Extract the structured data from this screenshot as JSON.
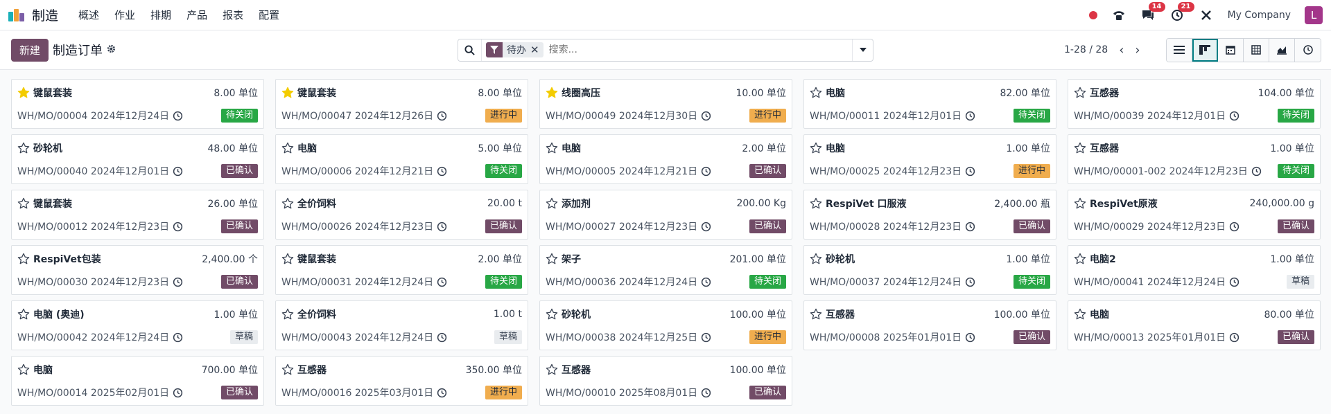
{
  "app": {
    "title": "制造",
    "menu": [
      "概述",
      "作业",
      "排期",
      "产品",
      "报表",
      "配置"
    ],
    "chat_count": "14",
    "activity_count": "21",
    "company": "My Company",
    "avatar_letter": "L"
  },
  "control": {
    "new_label": "新建",
    "page_title": "制造订单",
    "facet": "待办",
    "search_placeholder": "搜索...",
    "pager": "1-28 / 28"
  },
  "colors": {
    "brand": "#714b67",
    "to_close": "#28a745",
    "in_progress": "#f0ad4e",
    "confirmed": "#714b67",
    "draft": "#e9ecef",
    "star": "#f3cc00"
  },
  "records": [
    {
      "product": "键鼠套装",
      "qty": "8.00 单位",
      "ref": "WH/MO/00004 2024年12月24日",
      "status": "待关闭",
      "state": "toclose",
      "starred": true
    },
    {
      "product": "键鼠套装",
      "qty": "8.00 单位",
      "ref": "WH/MO/00047 2024年12月26日",
      "status": "进行中",
      "state": "progress",
      "starred": true
    },
    {
      "product": "线圈高压",
      "qty": "10.00 单位",
      "ref": "WH/MO/00049 2024年12月30日",
      "status": "进行中",
      "state": "progress",
      "starred": true
    },
    {
      "product": "电脑",
      "qty": "82.00 单位",
      "ref": "WH/MO/00011 2024年12月01日",
      "status": "待关闭",
      "state": "toclose",
      "starred": false
    },
    {
      "product": "互感器",
      "qty": "104.00 单位",
      "ref": "WH/MO/00039 2024年12月01日",
      "status": "待关闭",
      "state": "toclose",
      "starred": false
    },
    {
      "product": "砂轮机",
      "qty": "48.00 单位",
      "ref": "WH/MO/00040 2024年12月01日",
      "status": "已确认",
      "state": "confirmed",
      "starred": false
    },
    {
      "product": "电脑",
      "qty": "5.00 单位",
      "ref": "WH/MO/00006 2024年12月21日",
      "status": "待关闭",
      "state": "toclose",
      "starred": false
    },
    {
      "product": "电脑",
      "qty": "2.00 单位",
      "ref": "WH/MO/00005 2024年12月21日",
      "status": "已确认",
      "state": "confirmed",
      "starred": false
    },
    {
      "product": "电脑",
      "qty": "1.00 单位",
      "ref": "WH/MO/00025 2024年12月23日",
      "status": "进行中",
      "state": "progress",
      "starred": false
    },
    {
      "product": "互感器",
      "qty": "1.00 单位",
      "ref": "WH/MO/00001-002 2024年12月23日",
      "status": "待关闭",
      "state": "toclose",
      "starred": false
    },
    {
      "product": "键鼠套装",
      "qty": "26.00 单位",
      "ref": "WH/MO/00012 2024年12月23日",
      "status": "已确认",
      "state": "confirmed",
      "starred": false
    },
    {
      "product": "全价饲料",
      "qty": "20.00 t",
      "ref": "WH/MO/00026 2024年12月23日",
      "status": "已确认",
      "state": "confirmed",
      "starred": false
    },
    {
      "product": "添加剂",
      "qty": "200.00 Kg",
      "ref": "WH/MO/00027 2024年12月23日",
      "status": "已确认",
      "state": "confirmed",
      "starred": false
    },
    {
      "product": "RespiVet 口服液",
      "qty": "2,400.00 瓶",
      "ref": "WH/MO/00028 2024年12月23日",
      "status": "已确认",
      "state": "confirmed",
      "starred": false
    },
    {
      "product": "RespiVet原液",
      "qty": "240,000.00 g",
      "ref": "WH/MO/00029 2024年12月23日",
      "status": "已确认",
      "state": "confirmed",
      "starred": false
    },
    {
      "product": "RespiVet包装",
      "qty": "2,400.00 个",
      "ref": "WH/MO/00030 2024年12月23日",
      "status": "已确认",
      "state": "confirmed",
      "starred": false
    },
    {
      "product": "键鼠套装",
      "qty": "2.00 单位",
      "ref": "WH/MO/00031 2024年12月24日",
      "status": "待关闭",
      "state": "toclose",
      "starred": false
    },
    {
      "product": "架子",
      "qty": "201.00 单位",
      "ref": "WH/MO/00036 2024年12月24日",
      "status": "待关闭",
      "state": "toclose",
      "starred": false
    },
    {
      "product": "砂轮机",
      "qty": "1.00 单位",
      "ref": "WH/MO/00037 2024年12月24日",
      "status": "待关闭",
      "state": "toclose",
      "starred": false
    },
    {
      "product": "电脑2",
      "qty": "1.00 单位",
      "ref": "WH/MO/00041 2024年12月24日",
      "status": "草稿",
      "state": "draft",
      "starred": false
    },
    {
      "product": "电脑 (奥迪)",
      "qty": "1.00 单位",
      "ref": "WH/MO/00042 2024年12月24日",
      "status": "草稿",
      "state": "draft",
      "starred": false
    },
    {
      "product": "全价饲料",
      "qty": "1.00 t",
      "ref": "WH/MO/00043 2024年12月24日",
      "status": "草稿",
      "state": "draft",
      "starred": false
    },
    {
      "product": "砂轮机",
      "qty": "100.00 单位",
      "ref": "WH/MO/00038 2024年12月25日",
      "status": "进行中",
      "state": "progress",
      "starred": false
    },
    {
      "product": "互感器",
      "qty": "100.00 单位",
      "ref": "WH/MO/00008 2025年01月01日",
      "status": "已确认",
      "state": "confirmed",
      "starred": false
    },
    {
      "product": "电脑",
      "qty": "80.00 单位",
      "ref": "WH/MO/00013 2025年01月01日",
      "status": "已确认",
      "state": "confirmed",
      "starred": false
    },
    {
      "product": "电脑",
      "qty": "700.00 单位",
      "ref": "WH/MO/00014 2025年02月01日",
      "status": "已确认",
      "state": "confirmed",
      "starred": false
    },
    {
      "product": "互感器",
      "qty": "350.00 单位",
      "ref": "WH/MO/00016 2025年03月01日",
      "status": "进行中",
      "state": "progress",
      "starred": false
    },
    {
      "product": "互感器",
      "qty": "100.00 单位",
      "ref": "WH/MO/00010 2025年08月01日",
      "status": "已确认",
      "state": "confirmed",
      "starred": false
    }
  ]
}
